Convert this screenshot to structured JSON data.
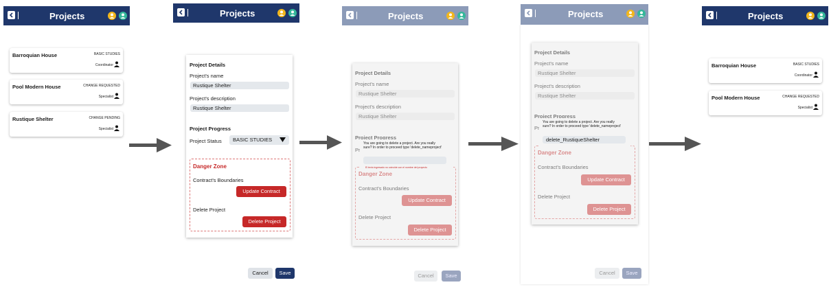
{
  "title": "Projects",
  "screen1": {
    "cards": [
      {
        "name": "Barroquian House",
        "status": "BASIC STUDIES",
        "role": "Coordinator"
      },
      {
        "name": "Pool Modern House",
        "status": "CHANGE REQUESTED",
        "role": "Specialist"
      },
      {
        "name": "Rustique Shelter",
        "status": "CHANGE PENDING",
        "role": "Specialist"
      }
    ]
  },
  "form": {
    "details_heading": "Project Details",
    "name_label": "Project's name",
    "name_value": "Rustique Shelter",
    "desc_label": "Project's description",
    "desc_value": "Rustique Shelter",
    "progress_heading": "Project Progress",
    "status_label": "Project Status",
    "status_value": "BASIC STUDIES",
    "danger_heading": "Danger Zone",
    "contract_label": "Contract's Boundaries",
    "update_button": "Update Contract",
    "delete_label": "Delete Project",
    "delete_button": "Delete Project",
    "progress_partial": "Project Progress",
    "status_partial": "Pr"
  },
  "dialog": {
    "message": "You are going to delete a project. Are you really sure? In order to proceed type 'delete_nameproject'",
    "input_empty": "",
    "input_filled": "delete_RustiqueShelter",
    "error": "El texto ingresado no coincide con el nombre del proyecto"
  },
  "footer": {
    "cancel": "Cancel",
    "save": "Save"
  },
  "screen5": {
    "cards": [
      {
        "name": "Barroquian House",
        "status": "BASIC STUDIES",
        "role": "Coordinator"
      },
      {
        "name": "Pool Modern House",
        "status": "CHANGE REQUESTED",
        "role": "Specialist"
      }
    ]
  },
  "colors": {
    "header": "#1f376b",
    "danger": "#c62828",
    "avatar1": "#f2b61c",
    "avatar2": "#34b79a"
  },
  "icons": {
    "back": "chevron-left-icon",
    "avatar1": "user-avatar-icon",
    "avatar2": "user-avatar-icon",
    "role": "person-icon",
    "dropdown": "caret-down-icon",
    "flow": "arrow-right-icon"
  }
}
